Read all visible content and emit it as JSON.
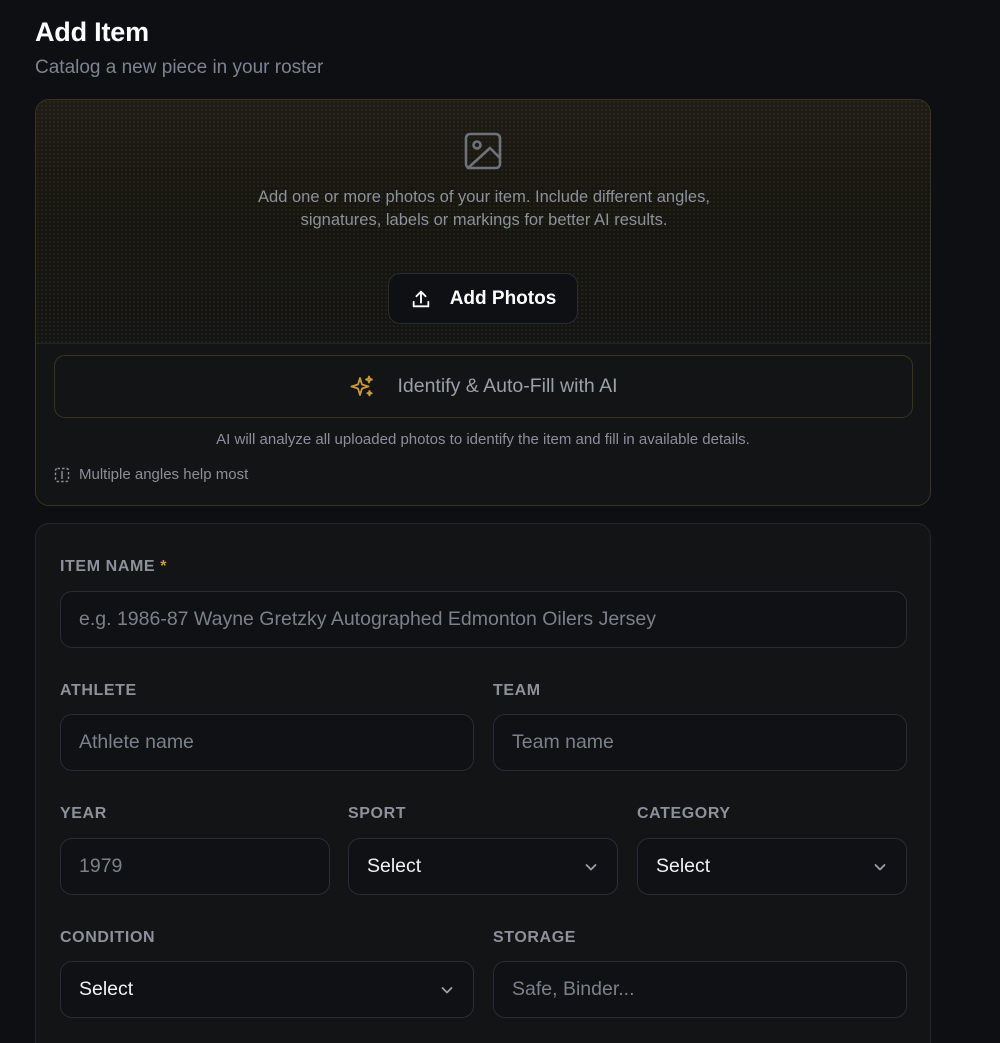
{
  "header": {
    "title": "Add Item",
    "subtitle": "Catalog a new piece in your roster"
  },
  "photos": {
    "instructions": "Add one or more photos of your item. Include different angles, signatures, labels or markings for better AI results.",
    "add_button": "Add Photos",
    "ai_button": "Identify & Auto-Fill with AI",
    "ai_note": "AI will analyze all uploaded photos to identify the item and fill in available details.",
    "hint": "Multiple angles help most"
  },
  "form": {
    "item_name": {
      "label": "ITEM NAME",
      "required_mark": "*",
      "placeholder": "e.g. 1986-87 Wayne Gretzky Autographed Edmonton Oilers Jersey"
    },
    "athlete": {
      "label": "ATHLETE",
      "placeholder": "Athlete name"
    },
    "team": {
      "label": "TEAM",
      "placeholder": "Team name"
    },
    "year": {
      "label": "YEAR",
      "placeholder": "1979"
    },
    "sport": {
      "label": "SPORT",
      "value": "Select"
    },
    "category": {
      "label": "CATEGORY",
      "value": "Select"
    },
    "condition": {
      "label": "CONDITION",
      "value": "Select"
    },
    "storage": {
      "label": "STORAGE",
      "placeholder": "Safe, Binder..."
    }
  },
  "colors": {
    "accent": "#c99a3c",
    "background": "#0d0f12",
    "card": "#131416"
  },
  "icons": [
    "image-icon",
    "upload-icon",
    "sparkle-icon",
    "angles-icon",
    "chevron-down-icon"
  ]
}
